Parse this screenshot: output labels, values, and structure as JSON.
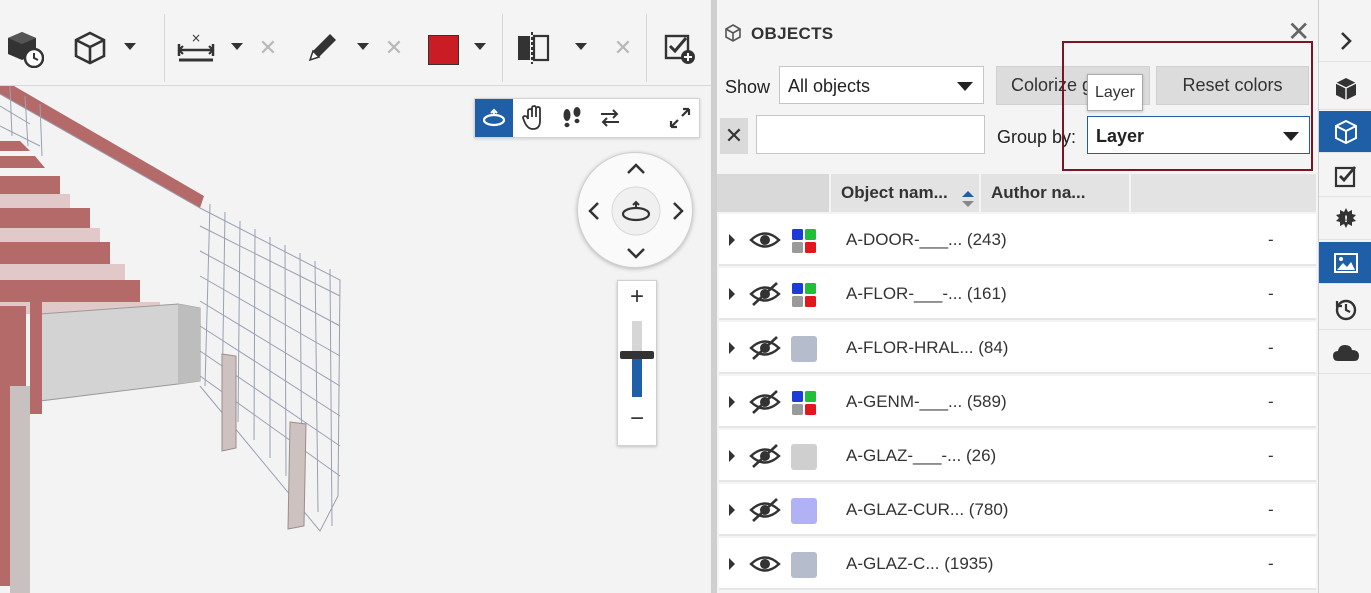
{
  "toolbar": {
    "tools": [
      {
        "name": "model-clock-icon"
      },
      {
        "name": "cube-view-icon"
      },
      {
        "name": "measure-icon"
      },
      {
        "name": "pencil-icon"
      },
      {
        "name": "color-picker"
      },
      {
        "name": "section-plane-icon"
      },
      {
        "name": "checklist-add-icon"
      }
    ],
    "markup_color": "#c91c24"
  },
  "viewport": {
    "nav_modes": [
      "orbit",
      "pan",
      "walk",
      "swap",
      "fit"
    ],
    "active_mode": "orbit",
    "zoom_level": 0.45
  },
  "panel": {
    "title": "OBJECTS",
    "show_label": "Show",
    "show_value": "All objects",
    "colorize_button": "Colorize g",
    "tooltip": "Layer",
    "reset_button": "Reset colors",
    "filter_value": "",
    "group_by_label": "Group by:",
    "group_by_value": "Layer",
    "columns": [
      "Object nam...",
      "Author na..."
    ],
    "rows": [
      {
        "name": "A-DOOR-___... (243)",
        "author": "-",
        "visible": true,
        "swatch": "multi"
      },
      {
        "name": "A-FLOR-___-... (161)",
        "author": "-",
        "visible": false,
        "swatch": "multi"
      },
      {
        "name": "A-FLOR-HRAL... (84)",
        "author": "-",
        "visible": false,
        "swatch": "#b5bccc"
      },
      {
        "name": "A-GENM-___... (589)",
        "author": "-",
        "visible": false,
        "swatch": "multi"
      },
      {
        "name": "A-GLAZ-___-... (26)",
        "author": "-",
        "visible": false,
        "swatch": "#cfcfcf"
      },
      {
        "name": "A-GLAZ-CUR... (780)",
        "author": "-",
        "visible": false,
        "swatch": "#b0b2f5"
      },
      {
        "name": "A-GLAZ-C... (1935)",
        "author": "-",
        "visible": true,
        "swatch": "#b5bccc"
      }
    ]
  },
  "rail": {
    "items": [
      "collapse",
      "model",
      "objects",
      "checklist",
      "issues",
      "images",
      "history",
      "cloud"
    ],
    "active": [
      "objects",
      "images"
    ]
  },
  "colors": {
    "accent": "#1e5fa8",
    "highlight_border": "#7a1526"
  }
}
